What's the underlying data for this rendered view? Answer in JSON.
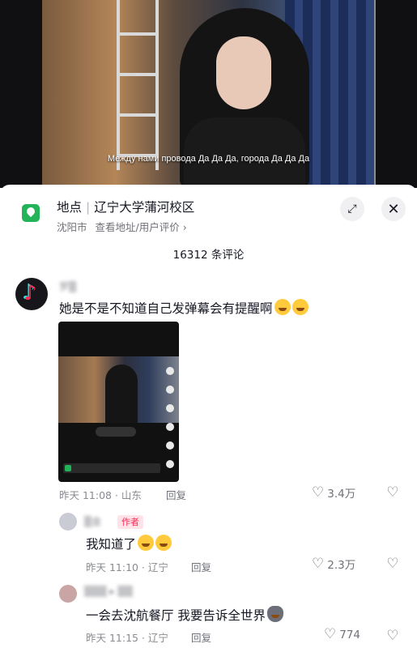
{
  "video": {
    "subtitle": "Между нами провода Да Да Да, города Да Да Да"
  },
  "location": {
    "label": "地点",
    "name": "辽宁大学蒲河校区",
    "city": "沈阳市",
    "links": "查看地址/用户评价 ›"
  },
  "comments_header": {
    "count_text": "16312 条评论"
  },
  "comments": [
    {
      "username": "罗▒",
      "text": "她是不是不知道自己发弹幕会有提醒啊",
      "time_location": "昨天 11:08 · 山东",
      "reply_label": "回复",
      "likes": "3.4万"
    },
    {
      "username": "▒金",
      "author_tag": "作者",
      "text": "我知道了",
      "time_location": "昨天 11:10 · 辽宁",
      "reply_label": "回复",
      "likes": "2.3万"
    },
    {
      "username": "▒▒▒ ▸ ▒▒",
      "text": "一会去沈航餐厅 我要告诉全世界",
      "time_location": "昨天 11:15 · 辽宁",
      "reply_label": "回复",
      "likes": "774"
    }
  ],
  "colors": {
    "accent": "#fe2c55",
    "location_icon": "#23b45a"
  }
}
